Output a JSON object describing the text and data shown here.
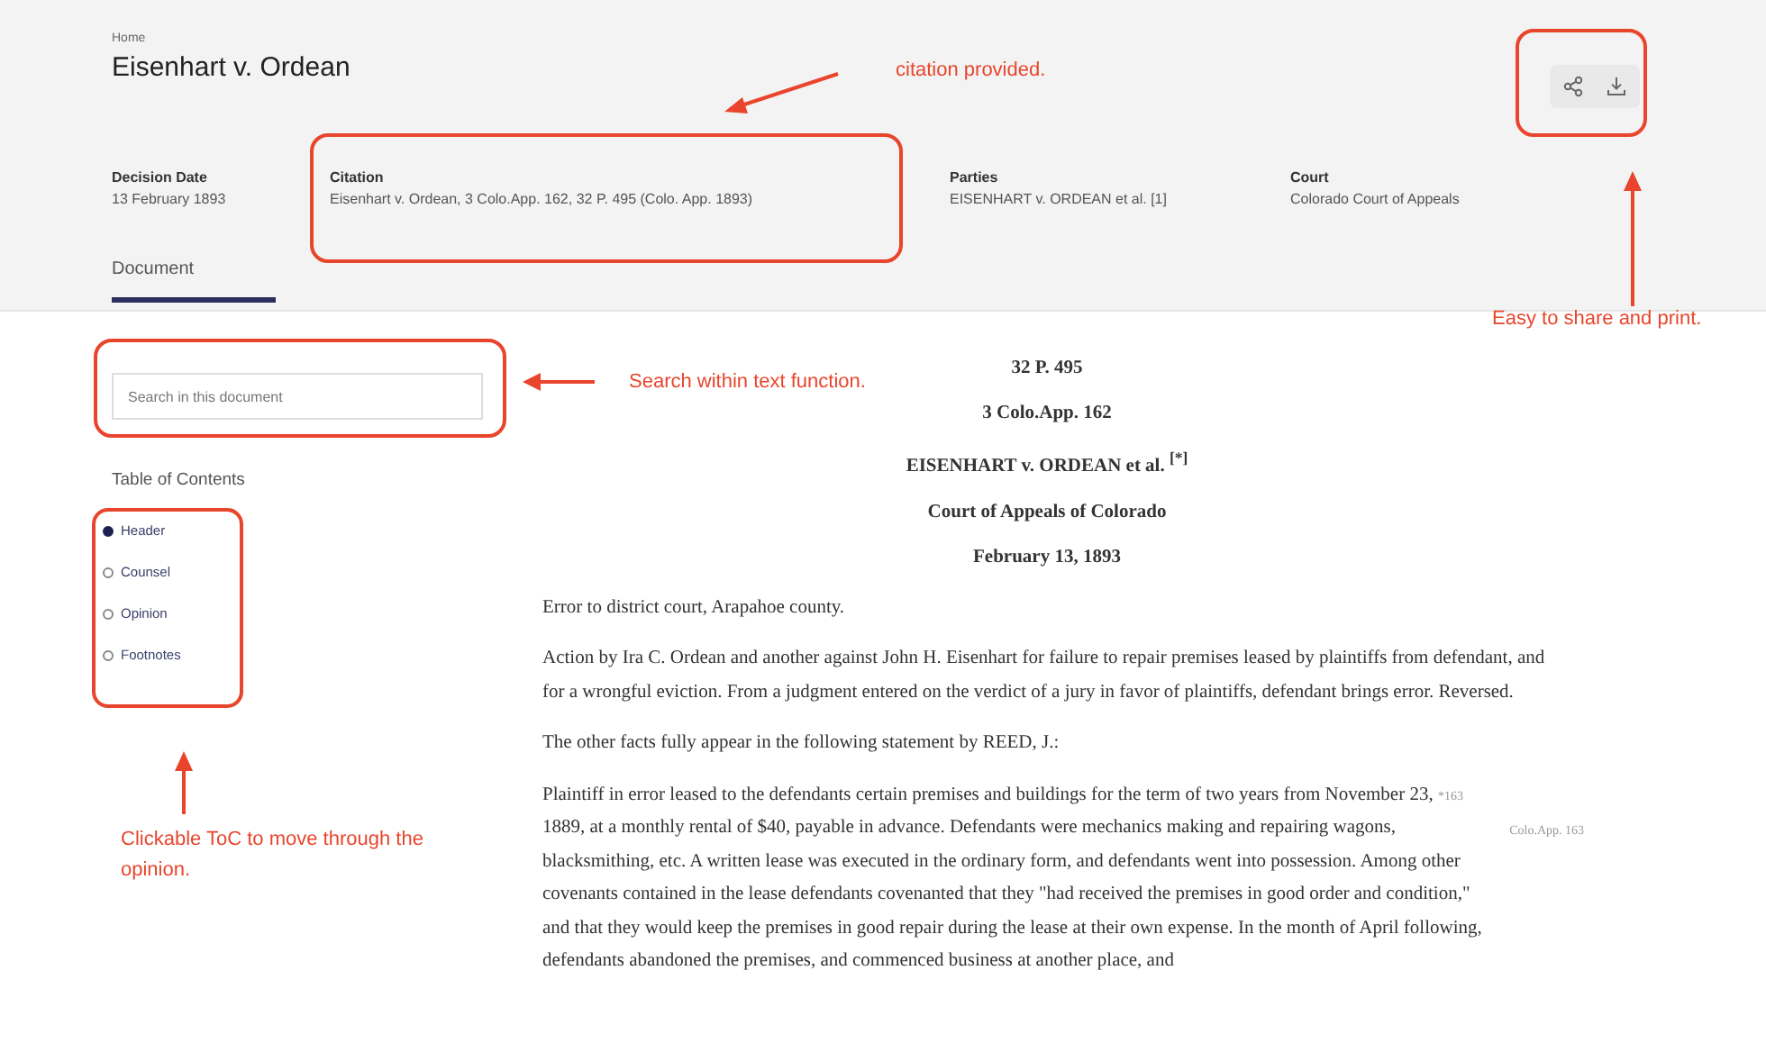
{
  "breadcrumb": "Home",
  "title": "Eisenhart v. Ordean",
  "meta": [
    {
      "label": "Decision Date",
      "value": "13 February 1893"
    },
    {
      "label": "Citation",
      "value": "Eisenhart v. Ordean, 3 Colo.App. 162, 32 P. 495 (Colo. App. 1893)"
    },
    {
      "label": "Parties",
      "value": "EISENHART v. ORDEAN et al. [1]"
    },
    {
      "label": "Court",
      "value": "Colorado Court of Appeals"
    }
  ],
  "tabs": [
    {
      "label": "Document",
      "selected": true
    }
  ],
  "search": {
    "placeholder": "Search in this document"
  },
  "toc": {
    "title": "Table of Contents",
    "items": [
      {
        "label": "Header",
        "selected": true
      },
      {
        "label": "Counsel",
        "selected": false
      },
      {
        "label": "Opinion",
        "selected": false
      },
      {
        "label": "Footnotes",
        "selected": false
      }
    ]
  },
  "document": {
    "headings": [
      "32 P. 495",
      "3 Colo.App. 162",
      "EISENHART v. ORDEAN et al. $^{[*]}$",
      "Court of Appeals of Colorado",
      "February 13, 1893"
    ],
    "paragraphs": [
      {
        "text": "Error to district court, Arapahoe county."
      },
      {
        "text": "Action by Ira C. Ordean and another against John H. Eisenhart for failure to repair premises leased by plaintiffs from defendant, and for a wrongful eviction. From a judgment entered on the verdict of a jury in favor of plaintiffs, defendant brings error. Reversed."
      },
      {
        "text": "The other facts fully appear in the following statement by REED, J.:"
      },
      {
        "text": "Plaintiff in error leased to the defendants certain premises and buildings for the term of two years from November 23,",
        "page_marker": "*163",
        "text_after": "1889, at a monthly rental of $40, payable in advance. Defendants were mechanics making and repairing wagons, blacksmithing, etc. A written lease was executed in the ordinary form, and defendants went into possession. Among other covenants contained in the lease defendants covenanted that they \"had received the premises in good order and condition,\" and that they would keep the premises in good repair during the lease at their own expense. In the month of April following, defendants abandoned the premises, and commenced business at another place, and",
        "margin_note": "Colo.App. 163"
      }
    ]
  },
  "annotations": [
    {
      "text": "citation provided."
    },
    {
      "text": "Easy to share and print."
    },
    {
      "text": "Search within text function."
    },
    {
      "text": "Clickable ToC to move through the opinion."
    }
  ]
}
